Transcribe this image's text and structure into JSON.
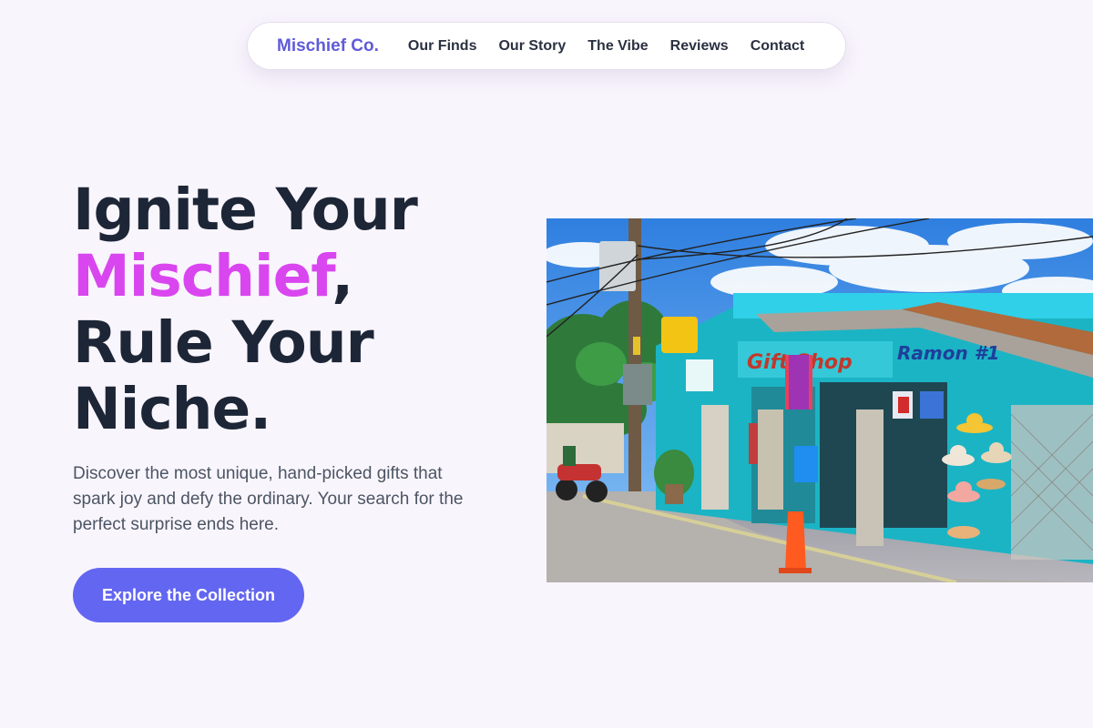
{
  "nav": {
    "brand": "Mischief Co.",
    "links": [
      "Our Finds",
      "Our Story",
      "The Vibe",
      "Reviews",
      "Contact"
    ]
  },
  "hero": {
    "headline": {
      "line1": "Ignite Your",
      "accent": "Mischief",
      "comma": ",",
      "line3": "Rule Your",
      "line4": "Niche."
    },
    "description": "Discover the most unique, hand-picked gifts that spark joy and defy the ordinary. Your search for the perfect surprise ends here.",
    "cta_label": "Explore the Collection",
    "image": {
      "shop_sign": "Gift Shop",
      "shop_sign_2": "Ramon #1",
      "icon": "street-gift-shop-photo"
    }
  },
  "colors": {
    "background": "#f9f5fd",
    "brand": "#5f5bd8",
    "accent": "#d946ef",
    "heading": "#1d2636",
    "body_text": "#4b5563",
    "button": "#6366f1"
  }
}
